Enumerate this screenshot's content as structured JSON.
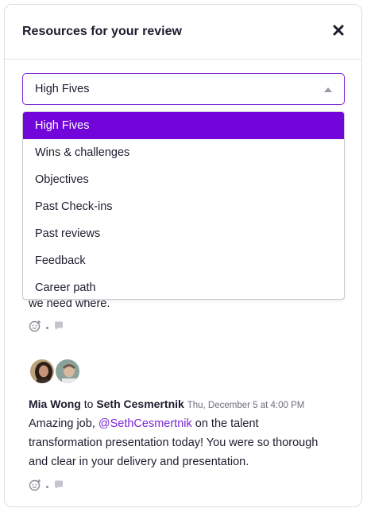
{
  "modal": {
    "title": "Resources for your review"
  },
  "resource_select": {
    "value": "High Fives",
    "options": [
      "High Fives",
      "Wins & challenges",
      "Objectives",
      "Past Check-ins",
      "Past reviews",
      "Feedback",
      "Career path"
    ]
  },
  "feed": {
    "truncated_text": "we need where.",
    "post": {
      "author": "Mia Wong",
      "to_word": "to",
      "recipient": "Seth Cesmertnik",
      "timestamp": "Thu, December 5 at 4:00 PM",
      "body_start": "Amazing job, ",
      "mention": "@SethCesmertnik",
      "body_line1_end": " on the talent",
      "body_line2": "transformation presentation today! You were so thorough",
      "body_line3": "and clear in your delivery and presentation."
    }
  },
  "icons": {
    "close": "close-icon",
    "caret": "caret-up-icon",
    "reaction": "add-reaction-icon",
    "comment": "comment-icon"
  },
  "colors": {
    "accent": "#7205d9",
    "mention": "#7b24d6",
    "text": "#1f1a2e",
    "muted": "#8f8d99"
  }
}
